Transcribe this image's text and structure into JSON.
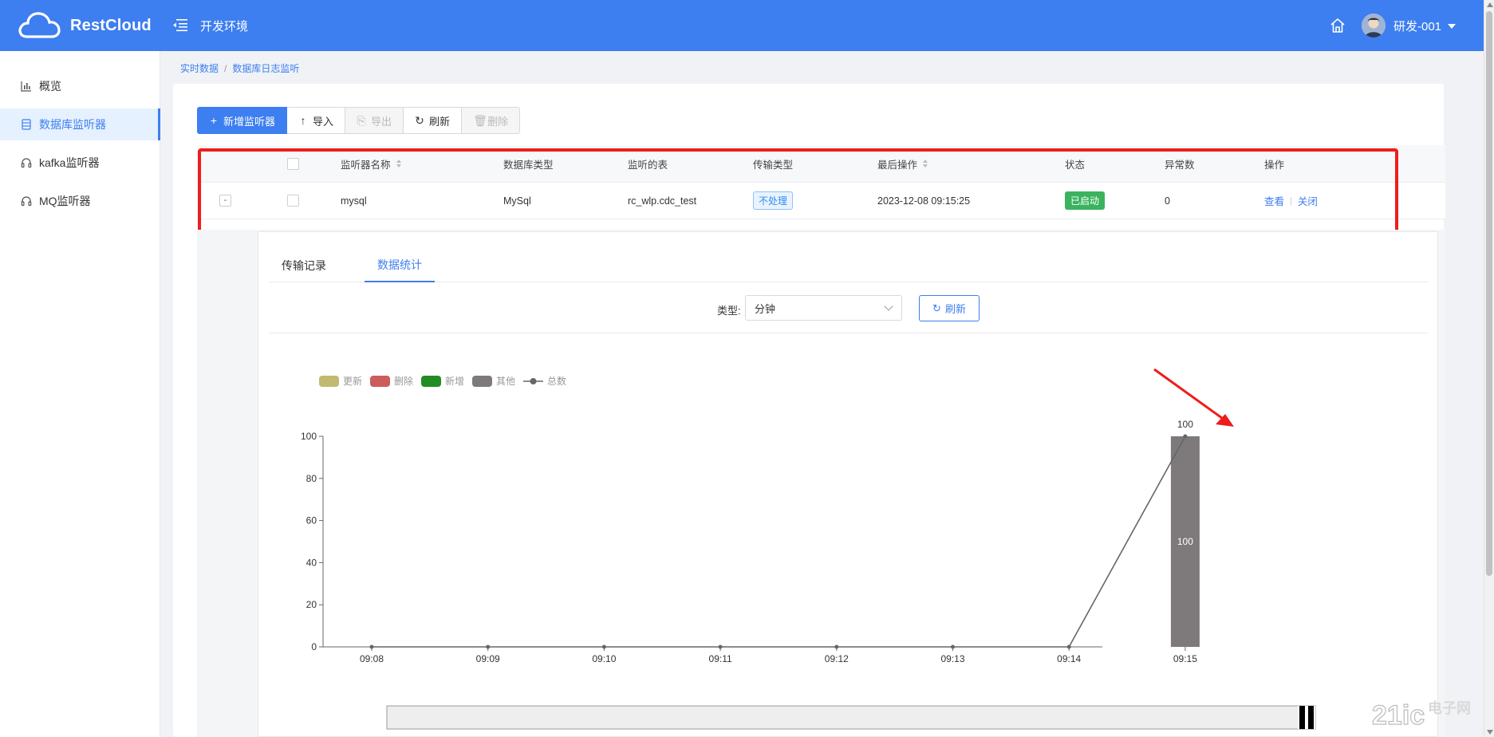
{
  "header": {
    "logo_text": "RestCloud",
    "env_title": "开发环境",
    "user_name": "研发-001"
  },
  "sidebar": {
    "items": [
      {
        "label": "概览",
        "icon": "bar-chart-icon"
      },
      {
        "label": "数据库监听器",
        "icon": "database-icon",
        "active": true
      },
      {
        "label": "kafka监听器",
        "icon": "headset-icon"
      },
      {
        "label": "MQ监听器",
        "icon": "headset-icon"
      }
    ]
  },
  "breadcrumb": {
    "items": [
      "实时数据",
      "数据库日志监听"
    ]
  },
  "toolbar": {
    "add_label": "新增监听器",
    "import_label": "导入",
    "export_label": "导出",
    "refresh_label": "刷新",
    "delete_label": "删除"
  },
  "table": {
    "headers": {
      "name": "监听器名称",
      "db_type": "数据库类型",
      "table": "监听的表",
      "transfer": "传输类型",
      "last_op": "最后操作",
      "status": "状态",
      "errors": "异常数",
      "actions": "操作"
    },
    "rows": [
      {
        "expand": "-",
        "name": "mysql",
        "db_type": "MySql",
        "table": "rc_wlp.cdc_test",
        "transfer": "不处理",
        "last_op": "2023-12-08 09:15:25",
        "status": "已启动",
        "errors": "0",
        "view": "查看",
        "close": "关闭"
      }
    ]
  },
  "detail": {
    "tabs": [
      {
        "label": "传输记录",
        "active": false
      },
      {
        "label": "数据统计",
        "active": true
      }
    ],
    "filter": {
      "type_label": "类型:",
      "type_value": "分钟",
      "refresh_label": "刷新"
    }
  },
  "chart_data": {
    "type": "bar",
    "categories": [
      "09:08",
      "09:09",
      "09:10",
      "09:11",
      "09:12",
      "09:13",
      "09:14",
      "09:15"
    ],
    "series": [
      {
        "name": "更新",
        "type": "bar",
        "color": "#c2b970",
        "values": [
          0,
          0,
          0,
          0,
          0,
          0,
          0,
          0
        ]
      },
      {
        "name": "删除",
        "type": "bar",
        "color": "#cd5c5c",
        "values": [
          0,
          0,
          0,
          0,
          0,
          0,
          0,
          0
        ]
      },
      {
        "name": "新增",
        "type": "bar",
        "color": "#228b22",
        "values": [
          0,
          0,
          0,
          0,
          0,
          0,
          0,
          0
        ]
      },
      {
        "name": "其他",
        "type": "bar",
        "color": "#7e7a7b",
        "values": [
          0,
          0,
          0,
          0,
          0,
          0,
          0,
          100
        ]
      },
      {
        "name": "总数",
        "type": "line",
        "color": "#666666",
        "values": [
          0,
          0,
          0,
          0,
          0,
          0,
          0,
          100
        ]
      }
    ],
    "yticks": [
      0,
      20,
      40,
      60,
      80,
      100
    ],
    "ylim": [
      0,
      100
    ],
    "legend_position": "top-left"
  }
}
